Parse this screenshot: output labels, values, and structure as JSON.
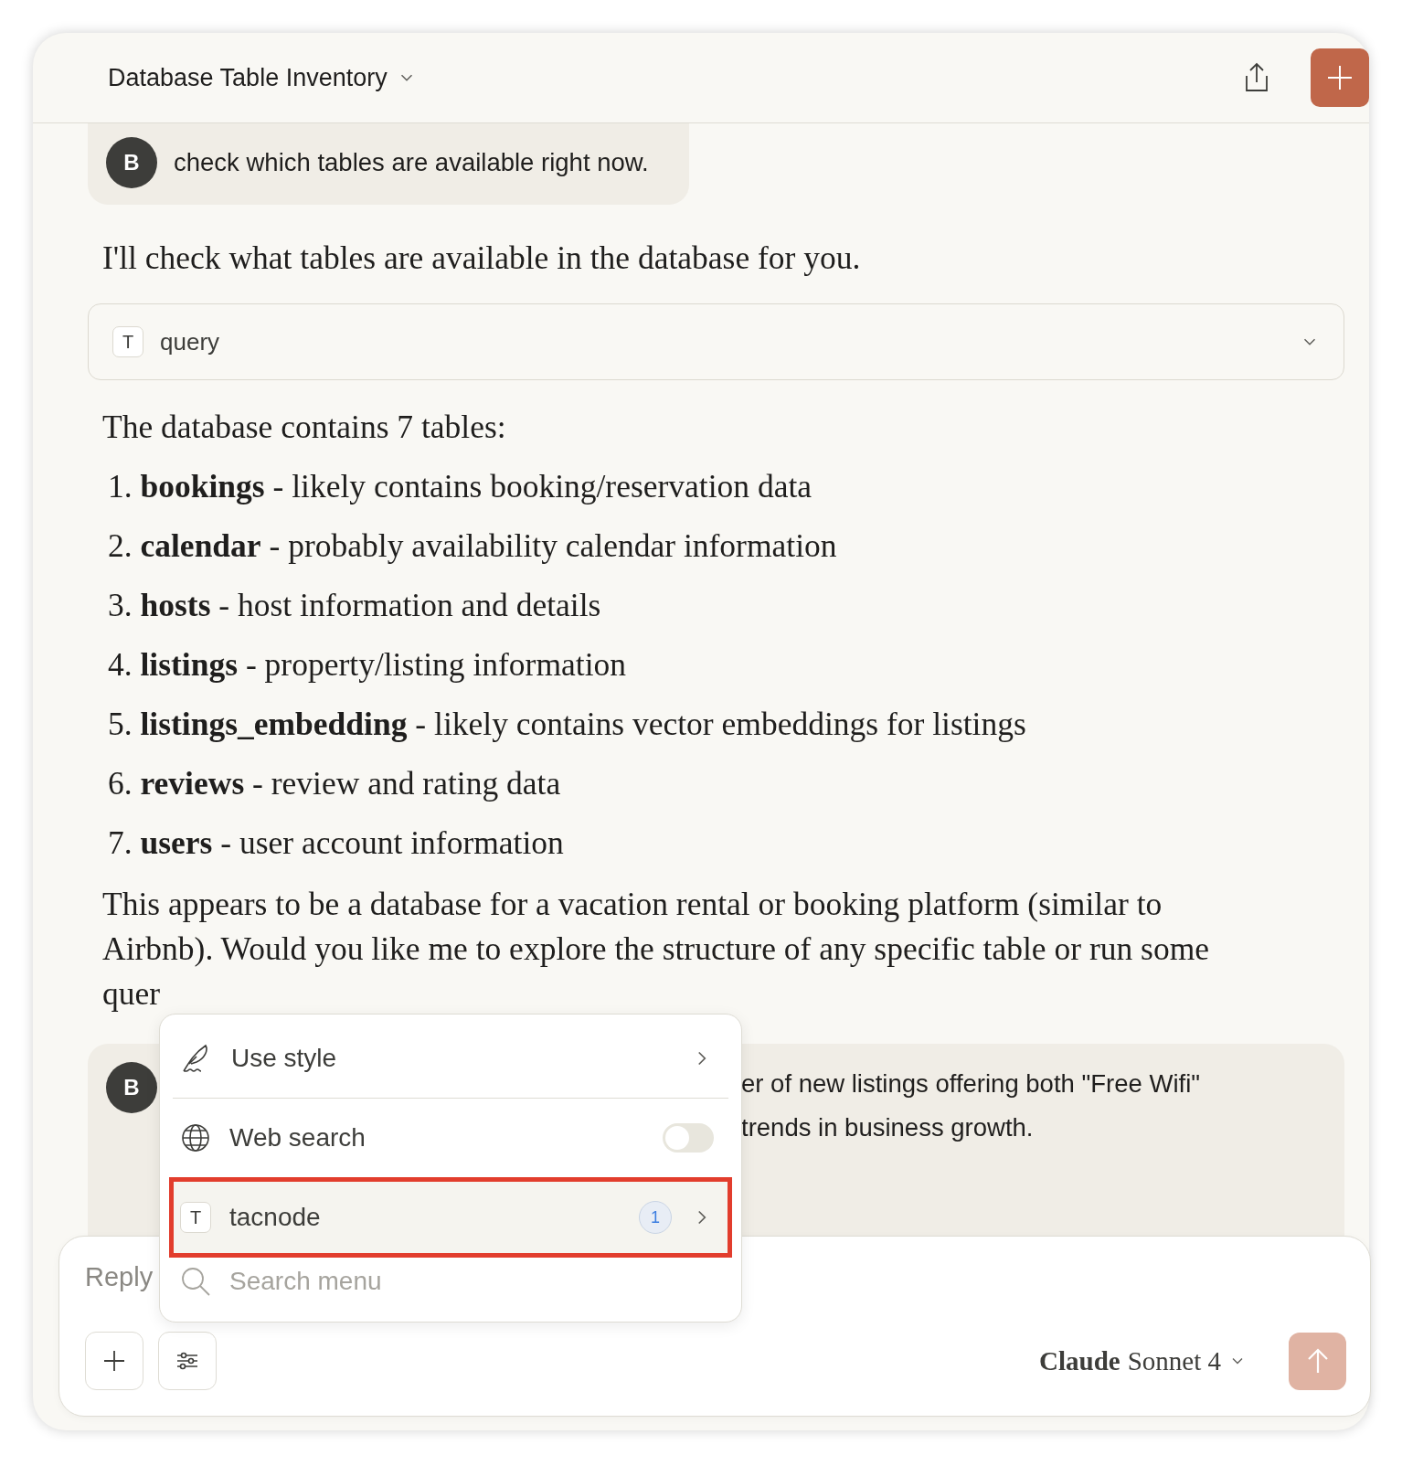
{
  "header": {
    "title": "Database Table Inventory"
  },
  "user_message_1": {
    "avatar": "B",
    "text": "check which tables are available right now."
  },
  "assistant": {
    "intro": "I'll check what tables are available in the database for you.",
    "tool_call": {
      "icon_letter": "T",
      "label": "query",
      "expanded": false
    },
    "summary": "The database contains 7 tables:",
    "list": [
      "1. **bookings** - likely contains booking/reservation data",
      "2. **calendar** - probably availability calendar information",
      "3. **hosts** - host information and details",
      "4. **listings** - property/listing information",
      "5. **listings_embedding** - likely contains vector embeddings for listings",
      "6. **reviews** - review and rating data",
      "7. **users** - user account information"
    ],
    "closing": "This appears to be a database for a vacation rental or booking platform (similar to Airbnb). Would you like me to explore the structure of any specific table or run some quer"
  },
  "user_message_2": {
    "avatar": "B",
    "lines": [
      "er of new listings offering both \"Free Wifi\"",
      "trends in business growth."
    ]
  },
  "menu": {
    "items": [
      {
        "kind": "submenu",
        "label": "Use style",
        "selected": false
      },
      {
        "kind": "toggle",
        "label": "Web search",
        "on": false,
        "selected": false
      },
      {
        "kind": "tool",
        "icon_letter": "T",
        "label": "tacnode",
        "badge": "1",
        "selected": true
      }
    ],
    "search_placeholder": "Search menu"
  },
  "composer": {
    "placeholder": "Reply",
    "model_brand": "Claude",
    "model_name": "Sonnet 4"
  }
}
